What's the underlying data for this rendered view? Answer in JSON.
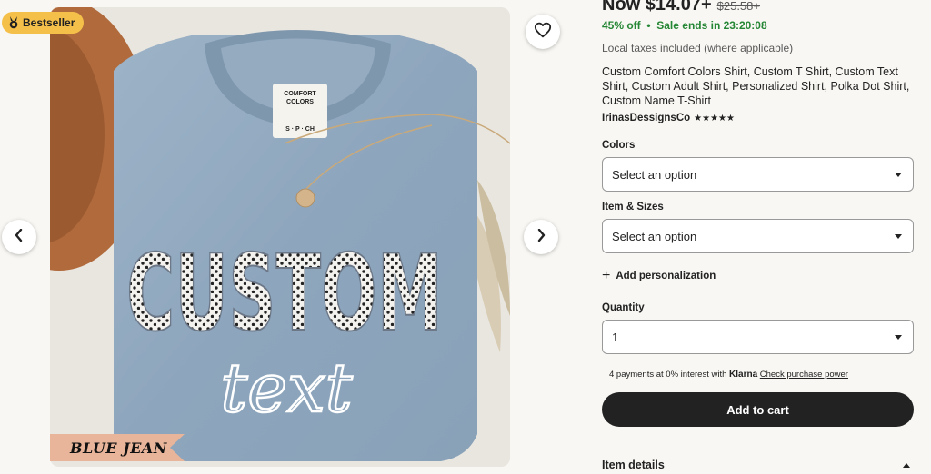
{
  "gallery": {
    "badge_label": "Bestseller",
    "image_text_main": "CUSTOM",
    "image_text_script": "text",
    "tag_text": "BLUE JEAN",
    "neck_label": [
      "COMFORT",
      "COLORS"
    ],
    "neck_size": "S · P · CH"
  },
  "listing": {
    "price_now": "Now $14.07+",
    "price_original": "$25.58+",
    "discount": "45% off",
    "sale_ends": "Sale ends in 23:20:08",
    "taxes_note": "Local taxes included (where applicable)",
    "title": "Custom Comfort Colors Shirt, Custom T Shirt, Custom Text Shirt, Custom Adult Shirt, Personalized Shirt, Polka Dot Shirt, Custom Name T-Shirt",
    "shop_name": "IrinasDessignsCo",
    "rating_stars": "★★★★★"
  },
  "options": {
    "colors_label": "Colors",
    "colors_value": "Select an option",
    "sizes_label": "Item & Sizes",
    "sizes_value": "Select an option",
    "personalization_label": "Add personalization",
    "quantity_label": "Quantity",
    "quantity_value": "1"
  },
  "payment": {
    "klarna_text": "4 payments at 0% interest with",
    "klarna_brand": "Klarna",
    "klarna_link": "Check purchase power"
  },
  "actions": {
    "add_to_cart": "Add to cart",
    "item_details": "Item details"
  },
  "colors": {
    "accent_green": "#258635",
    "badge_yellow": "#f5c04a",
    "cart_button": "#222222",
    "shirt_blue": "#8fa8bf"
  },
  "icons": {
    "badge": "medal-icon",
    "favorite": "heart-icon",
    "prev": "chevron-left-icon",
    "next": "chevron-right-icon",
    "dropdown": "caret-down-icon",
    "add": "plus-icon",
    "collapse": "caret-up-icon"
  }
}
